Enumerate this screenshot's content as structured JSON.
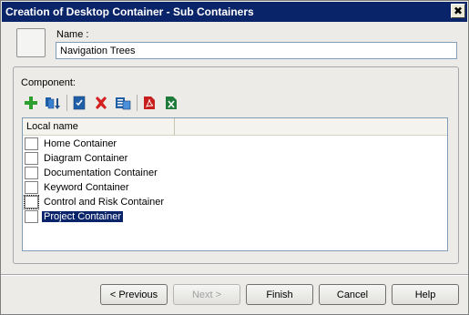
{
  "window": {
    "title": "Creation of Desktop Container - Sub Containers",
    "close_glyph": "✖"
  },
  "name": {
    "label": "Name :",
    "value": "Navigation Trees"
  },
  "component": {
    "label": "Component:",
    "toolbar": [
      {
        "icon": "add-icon"
      },
      {
        "icon": "import-icon"
      },
      {
        "icon": "save-icon"
      },
      {
        "icon": "delete-icon"
      },
      {
        "icon": "properties-icon"
      },
      {
        "icon": "pdf-icon"
      },
      {
        "icon": "excel-icon"
      }
    ],
    "column_header": "Local name",
    "items": [
      {
        "label": "Home Container",
        "checked": false
      },
      {
        "label": "Diagram Container",
        "checked": false
      },
      {
        "label": "Documentation Container",
        "checked": false
      },
      {
        "label": "Keyword Container",
        "checked": false
      },
      {
        "label": "Control and Risk Container",
        "checked": false
      },
      {
        "label": "Project Container",
        "checked": false,
        "selected": true
      }
    ]
  },
  "buttons": {
    "previous": "< Previous",
    "next": "Next >",
    "finish": "Finish",
    "cancel": "Cancel",
    "help": "Help"
  },
  "colors": {
    "titlebar": "#0a246a",
    "selection": "#0a246a",
    "add_green": "#2e9e2e",
    "delete_red": "#d42020"
  }
}
